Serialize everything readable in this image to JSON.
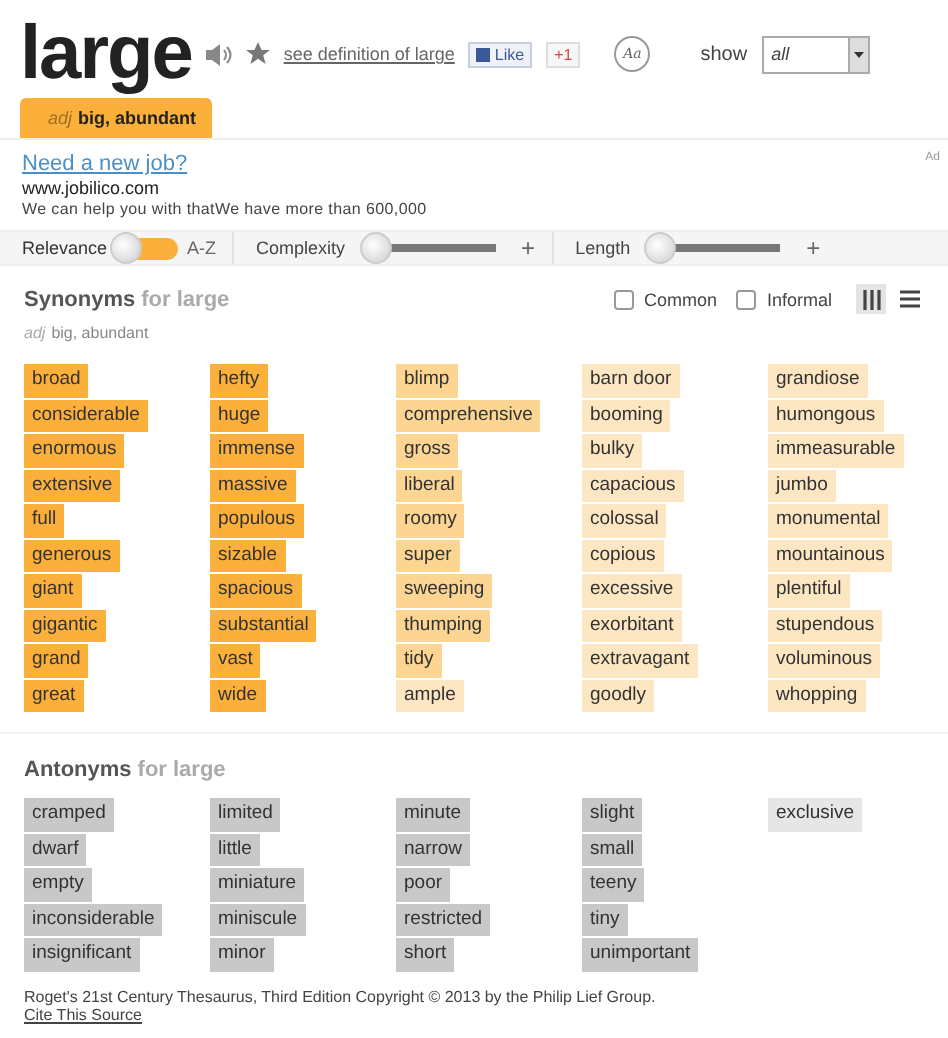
{
  "header": {
    "word": "large",
    "definition_link": "see definition of large",
    "like_button": "Like",
    "plusone_button": "+1",
    "font_button": "Aa",
    "show_label": "show",
    "show_value": "all"
  },
  "sense_tab": {
    "pos": "adj",
    "label": "big, abundant",
    "selected": true
  },
  "ad": {
    "title": "Need a new job?",
    "url": "www.jobilico.com",
    "text": "We can help you with thatWe have more than 600,000",
    "badge": "Ad"
  },
  "filters": {
    "sort_options": [
      {
        "label": "Relevance",
        "selected": true
      },
      {
        "label": "A-Z",
        "selected": false
      }
    ],
    "complexity": {
      "label": "Complexity",
      "level": 0
    },
    "length": {
      "label": "Length",
      "level": 0
    },
    "plus": "+"
  },
  "synonyms": {
    "title": "Synonyms",
    "for": "for large",
    "sense_pos": "adj",
    "sense": "big, abundant",
    "common": {
      "label": "Common",
      "checked": false
    },
    "informal": {
      "label": "Informal",
      "checked": false
    },
    "view_columns_selected": true,
    "columns": [
      [
        {
          "text": "broad",
          "color": "#fbb03b"
        },
        {
          "text": "considerable",
          "color": "#fbb03b"
        },
        {
          "text": "enormous",
          "color": "#fbb03b"
        },
        {
          "text": "extensive",
          "color": "#fbb03b"
        },
        {
          "text": "full",
          "color": "#fbb03b"
        },
        {
          "text": "generous",
          "color": "#fbb03b"
        },
        {
          "text": "giant",
          "color": "#fbb03b"
        },
        {
          "text": "gigantic",
          "color": "#fbb03b"
        },
        {
          "text": "grand",
          "color": "#fbb03b"
        },
        {
          "text": "great",
          "color": "#fbb03b"
        }
      ],
      [
        {
          "text": "hefty",
          "color": "#fbb03b"
        },
        {
          "text": "huge",
          "color": "#fbb03b"
        },
        {
          "text": "immense",
          "color": "#fbb03b"
        },
        {
          "text": "massive",
          "color": "#fbb03b"
        },
        {
          "text": "populous",
          "color": "#fbb03b"
        },
        {
          "text": "sizable",
          "color": "#fbb03b"
        },
        {
          "text": "spacious",
          "color": "#fbb03b"
        },
        {
          "text": "substantial",
          "color": "#fbb03b"
        },
        {
          "text": "vast",
          "color": "#fbb03b"
        },
        {
          "text": "wide",
          "color": "#fbb03b"
        }
      ],
      [
        {
          "text": "blimp",
          "color": "#fcd592"
        },
        {
          "text": "comprehensive",
          "color": "#fcd592"
        },
        {
          "text": "gross",
          "color": "#fcd592"
        },
        {
          "text": "liberal",
          "color": "#fcd592"
        },
        {
          "text": "roomy",
          "color": "#fcd592"
        },
        {
          "text": "super",
          "color": "#fcd592"
        },
        {
          "text": "sweeping",
          "color": "#fcd592"
        },
        {
          "text": "thumping",
          "color": "#fcd592"
        },
        {
          "text": "tidy",
          "color": "#fcd592"
        },
        {
          "text": "ample",
          "color": "#fde6c2"
        }
      ],
      [
        {
          "text": "barn door",
          "color": "#fde6c2"
        },
        {
          "text": "booming",
          "color": "#fde6c2"
        },
        {
          "text": "bulky",
          "color": "#fde6c2"
        },
        {
          "text": "capacious",
          "color": "#fde6c2"
        },
        {
          "text": "colossal",
          "color": "#fde6c2"
        },
        {
          "text": "copious",
          "color": "#fde6c2"
        },
        {
          "text": "excessive",
          "color": "#fde6c2"
        },
        {
          "text": "exorbitant",
          "color": "#fde6c2"
        },
        {
          "text": "extravagant",
          "color": "#fde6c2"
        },
        {
          "text": "goodly",
          "color": "#fde6c2"
        }
      ],
      [
        {
          "text": "grandiose",
          "color": "#fde6c2"
        },
        {
          "text": "humongous",
          "color": "#fde6c2"
        },
        {
          "text": "immeasurable",
          "color": "#fde6c2"
        },
        {
          "text": "jumbo",
          "color": "#fde6c2"
        },
        {
          "text": "monumental",
          "color": "#fde6c2"
        },
        {
          "text": "mountainous",
          "color": "#fde6c2"
        },
        {
          "text": "plentiful",
          "color": "#fde6c2"
        },
        {
          "text": "stupendous",
          "color": "#fde6c2"
        },
        {
          "text": "voluminous",
          "color": "#fde6c2"
        },
        {
          "text": "whopping",
          "color": "#fde6c2"
        }
      ]
    ]
  },
  "antonyms": {
    "title": "Antonyms",
    "for": "for large",
    "columns": [
      [
        {
          "text": "cramped",
          "color": "#c8c8c8"
        },
        {
          "text": "dwarf",
          "color": "#c8c8c8"
        },
        {
          "text": "empty",
          "color": "#c8c8c8"
        },
        {
          "text": "inconsiderable",
          "color": "#c8c8c8"
        },
        {
          "text": "insignificant",
          "color": "#c8c8c8"
        }
      ],
      [
        {
          "text": "limited",
          "color": "#c8c8c8"
        },
        {
          "text": "little",
          "color": "#c8c8c8"
        },
        {
          "text": "miniature",
          "color": "#c8c8c8"
        },
        {
          "text": "miniscule",
          "color": "#c8c8c8"
        },
        {
          "text": "minor",
          "color": "#c8c8c8"
        }
      ],
      [
        {
          "text": "minute",
          "color": "#c8c8c8"
        },
        {
          "text": "narrow",
          "color": "#c8c8c8"
        },
        {
          "text": "poor",
          "color": "#c8c8c8"
        },
        {
          "text": "restricted",
          "color": "#c8c8c8"
        },
        {
          "text": "short",
          "color": "#c8c8c8"
        }
      ],
      [
        {
          "text": "slight",
          "color": "#c8c8c8"
        },
        {
          "text": "small",
          "color": "#c8c8c8"
        },
        {
          "text": "teeny",
          "color": "#c8c8c8"
        },
        {
          "text": "tiny",
          "color": "#c8c8c8"
        },
        {
          "text": "unimportant",
          "color": "#c8c8c8"
        }
      ],
      [
        {
          "text": "exclusive",
          "color": "#e6e6e6"
        }
      ]
    ]
  },
  "footer": {
    "copyright": "Roget's 21st Century Thesaurus, Third Edition Copyright © 2013 by the Philip Lief Group.",
    "cite_link": "Cite This Source"
  }
}
